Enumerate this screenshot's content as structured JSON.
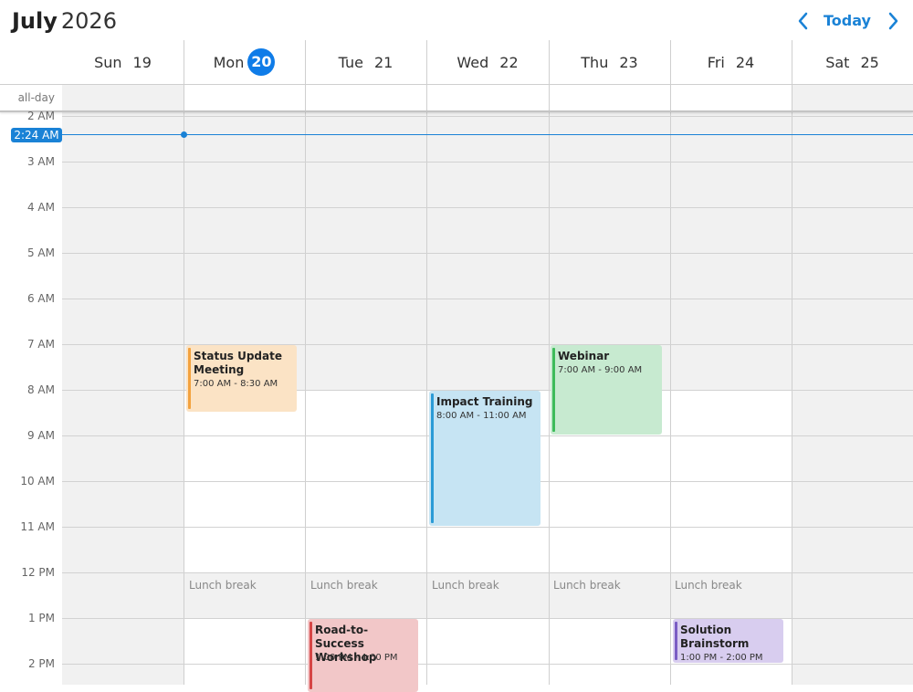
{
  "header": {
    "month": "July",
    "year": "2026",
    "today_label": "Today",
    "prev_icon": "chevron-left-icon",
    "next_icon": "chevron-right-icon",
    "accent_color": "#1a82d6"
  },
  "days": [
    {
      "name": "Sun",
      "num": "19",
      "today": false
    },
    {
      "name": "Mon",
      "num": "20",
      "today": true
    },
    {
      "name": "Tue",
      "num": "21",
      "today": false
    },
    {
      "name": "Wed",
      "num": "22",
      "today": false
    },
    {
      "name": "Thu",
      "num": "23",
      "today": false
    },
    {
      "name": "Fri",
      "num": "24",
      "today": false
    },
    {
      "name": "Sat",
      "num": "25",
      "today": false
    }
  ],
  "allday_label": "all-day",
  "times": [
    "2 AM",
    "3 AM",
    "4 AM",
    "5 AM",
    "6 AM",
    "7 AM",
    "8 AM",
    "9 AM",
    "10 AM",
    "11 AM",
    "12 PM",
    "1 PM",
    "2 PM"
  ],
  "now_indicator": "2:24 AM",
  "lunch_label": "Lunch break",
  "events": [
    {
      "title": "Status Update Meeting",
      "time": "7:00 AM - 8:30 AM",
      "bg": "#fbe3c5",
      "bar": "#f3a23e"
    },
    {
      "title": "Webinar",
      "time": "7:00 AM - 9:00 AM",
      "bg": "#c7ead0",
      "bar": "#3dbb5a"
    },
    {
      "title": "Impact Training",
      "time": "8:00 AM - 11:00 AM",
      "bg": "#c6e4f3",
      "bar": "#2b9bd6"
    },
    {
      "title": "Road-to-Success Workshop",
      "time": "1:00 PM - 4:00 PM",
      "bg": "#f2c7c8",
      "bar": "#d64545"
    },
    {
      "title": "Solution Brainstorm",
      "time": "1:00 PM - 2:00 PM",
      "bg": "#d8cdef",
      "bar": "#7a5cc4"
    }
  ]
}
